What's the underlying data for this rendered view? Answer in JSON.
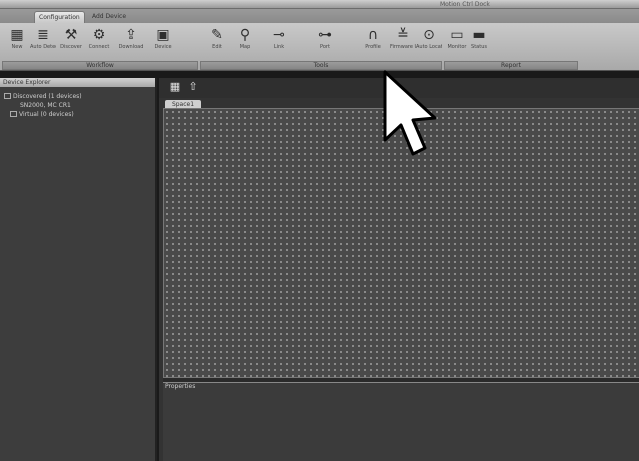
{
  "window": {
    "title": "Motion Ctrl Dock"
  },
  "tabs": [
    {
      "label": "Configuration",
      "active": true
    },
    {
      "label": "Add Device",
      "active": false
    }
  ],
  "ribbon": {
    "tools": [
      {
        "icon": "grid-icon",
        "glyph": "▦",
        "label": "New"
      },
      {
        "icon": "list-icon",
        "glyph": "≣",
        "label": "Auto Detect"
      },
      {
        "icon": "wand-icon",
        "glyph": "⚒",
        "label": "Discover"
      },
      {
        "icon": "network-icon",
        "glyph": "⚙",
        "label": "Connect"
      },
      {
        "icon": "upload-icon",
        "glyph": "⇪",
        "label": "Download"
      },
      {
        "icon": "device-icon",
        "glyph": "▣",
        "label": "Device"
      },
      {
        "icon": "wrench-icon",
        "glyph": "✎",
        "label": "Edit"
      },
      {
        "icon": "link-icon",
        "glyph": "⚲",
        "label": "Map"
      },
      {
        "icon": "plug-icon",
        "glyph": "⊸",
        "label": "Link"
      },
      {
        "icon": "settings-icon",
        "glyph": "⊶",
        "label": "Port"
      },
      {
        "icon": "arc-icon",
        "glyph": "∩",
        "label": "Profile"
      },
      {
        "icon": "firmware-icon",
        "glyph": "≚",
        "label": "Firmware Update"
      },
      {
        "icon": "locate-icon",
        "glyph": "⊙",
        "label": "Auto Locate"
      },
      {
        "icon": "monitor-icon",
        "glyph": "▭",
        "label": "Monitor"
      },
      {
        "icon": "status-icon",
        "glyph": "▬",
        "label": "Status"
      }
    ],
    "groups": [
      "Workflow",
      "Tools",
      "Report"
    ]
  },
  "sidebar": {
    "title": "Device Explorer",
    "items": [
      {
        "label": "Discovered (1 devices)"
      },
      {
        "label": "SN2000, MC CR1"
      },
      {
        "label": "Virtual (0 devices)"
      }
    ]
  },
  "main": {
    "doc_tab": "Space1",
    "properties_label": "Properties"
  }
}
